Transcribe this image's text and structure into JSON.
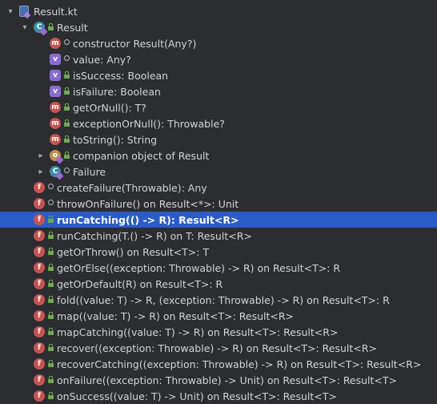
{
  "colors": {
    "background": "#2b2d30",
    "selection": "#2a5bc7",
    "function_icon": "#c75450",
    "method_icon": "#c75450",
    "property_icon": "#8b6ad4",
    "class_icon": "#3d8ea6",
    "object_icon": "#c2914a",
    "public_visibility": "#6ea953"
  },
  "rows": [
    {
      "label": "Result.kt",
      "icon": "kotlin-file-icon",
      "icon_letter": "",
      "visibility": "",
      "expanded": "down",
      "depth": 0
    },
    {
      "label": "Result",
      "icon": "class-icon",
      "icon_letter": "C",
      "visibility": "public",
      "expanded": "down",
      "depth": 1
    },
    {
      "label": "constructor Result(Any?)",
      "icon": "method-icon",
      "icon_letter": "m",
      "visibility": "internal",
      "expanded": "",
      "depth": 2
    },
    {
      "label": "value: Any?",
      "icon": "property-icon",
      "icon_letter": "v",
      "visibility": "internal",
      "expanded": "",
      "depth": 2
    },
    {
      "label": "isSuccess: Boolean",
      "icon": "property-icon",
      "icon_letter": "v",
      "visibility": "public",
      "expanded": "",
      "depth": 2
    },
    {
      "label": "isFailure: Boolean",
      "icon": "property-icon",
      "icon_letter": "v",
      "visibility": "public",
      "expanded": "",
      "depth": 2
    },
    {
      "label": "getOrNull(): T?",
      "icon": "method-icon",
      "icon_letter": "m",
      "visibility": "public",
      "expanded": "",
      "depth": 2
    },
    {
      "label": "exceptionOrNull(): Throwable?",
      "icon": "method-icon",
      "icon_letter": "m",
      "visibility": "public",
      "expanded": "",
      "depth": 2
    },
    {
      "label": "toString(): String",
      "icon": "method-icon",
      "icon_letter": "m",
      "visibility": "public",
      "expanded": "",
      "depth": 2
    },
    {
      "label": "companion object of Result",
      "icon": "object-icon",
      "icon_letter": "o",
      "visibility": "public",
      "expanded": "right",
      "depth": 2
    },
    {
      "label": "Failure",
      "icon": "class-icon",
      "icon_letter": "C",
      "visibility": "internal",
      "expanded": "right",
      "depth": 2
    },
    {
      "label": "createFailure(Throwable): Any",
      "icon": "function-icon",
      "icon_letter": "f",
      "visibility": "internal",
      "expanded": "",
      "depth": 1
    },
    {
      "label": "throwOnFailure() on Result<*>: Unit",
      "icon": "function-icon",
      "icon_letter": "f",
      "visibility": "internal",
      "expanded": "",
      "depth": 1
    },
    {
      "label": "runCatching(() -> R): Result<R>",
      "icon": "function-icon",
      "icon_letter": "f",
      "visibility": "public",
      "expanded": "",
      "depth": 1,
      "selected": true
    },
    {
      "label": "runCatching(T.() -> R) on T: Result<R>",
      "icon": "function-icon",
      "icon_letter": "f",
      "visibility": "public",
      "expanded": "",
      "depth": 1
    },
    {
      "label": "getOrThrow() on Result<T>: T",
      "icon": "function-icon",
      "icon_letter": "f",
      "visibility": "public",
      "expanded": "",
      "depth": 1
    },
    {
      "label": "getOrElse((exception: Throwable) -> R) on Result<T>: R",
      "icon": "function-icon",
      "icon_letter": "f",
      "visibility": "public",
      "expanded": "",
      "depth": 1
    },
    {
      "label": "getOrDefault(R) on Result<T>: R",
      "icon": "function-icon",
      "icon_letter": "f",
      "visibility": "public",
      "expanded": "",
      "depth": 1
    },
    {
      "label": "fold((value: T) -> R, (exception: Throwable) -> R) on Result<T>: R",
      "icon": "function-icon",
      "icon_letter": "f",
      "visibility": "public",
      "expanded": "",
      "depth": 1
    },
    {
      "label": "map((value: T) -> R) on Result<T>: Result<R>",
      "icon": "function-icon",
      "icon_letter": "f",
      "visibility": "public",
      "expanded": "",
      "depth": 1
    },
    {
      "label": "mapCatching((value: T) -> R) on Result<T>: Result<R>",
      "icon": "function-icon",
      "icon_letter": "f",
      "visibility": "public",
      "expanded": "",
      "depth": 1
    },
    {
      "label": "recover((exception: Throwable) -> R) on Result<T>: Result<R>",
      "icon": "function-icon",
      "icon_letter": "f",
      "visibility": "public",
      "expanded": "",
      "depth": 1
    },
    {
      "label": "recoverCatching((exception: Throwable) -> R) on Result<T>: Result<R>",
      "icon": "function-icon",
      "icon_letter": "f",
      "visibility": "public",
      "expanded": "",
      "depth": 1
    },
    {
      "label": "onFailure((exception: Throwable) -> Unit) on Result<T>: Result<T>",
      "icon": "function-icon",
      "icon_letter": "f",
      "visibility": "public",
      "expanded": "",
      "depth": 1
    },
    {
      "label": "onSuccess((value: T) -> Unit) on Result<T>: Result<T>",
      "icon": "function-icon",
      "icon_letter": "f",
      "visibility": "public",
      "expanded": "",
      "depth": 1
    }
  ]
}
